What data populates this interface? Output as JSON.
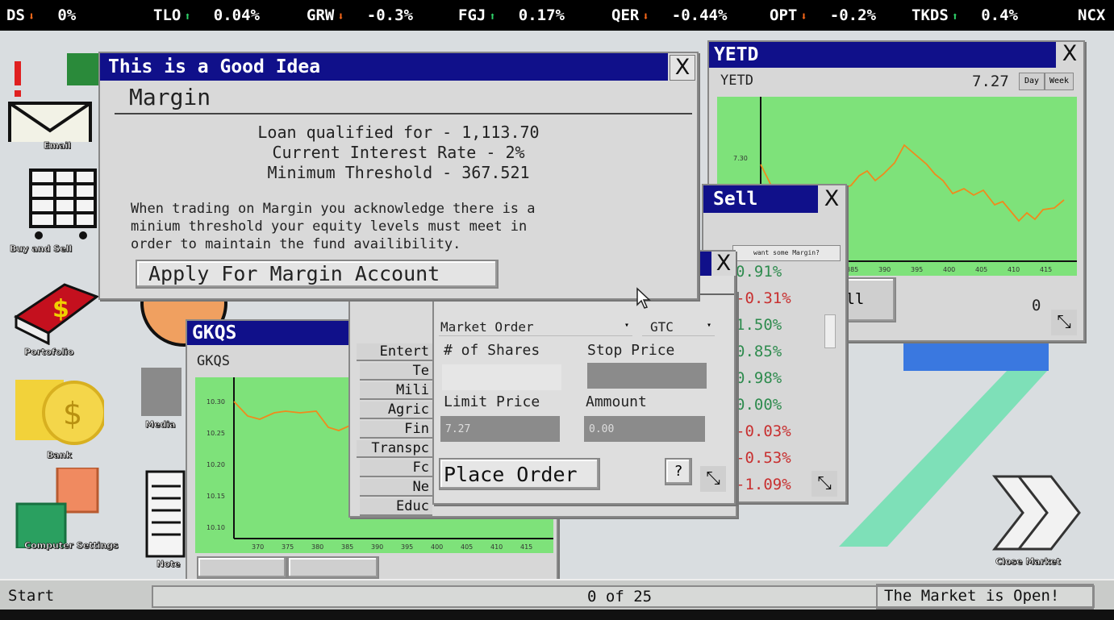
{
  "ticker": [
    {
      "sym": "DS",
      "dir": "down",
      "pct": "0%"
    },
    {
      "sym": "TLO",
      "dir": "up",
      "pct": "0.04%"
    },
    {
      "sym": "GRW",
      "dir": "down",
      "pct": "-0.3%"
    },
    {
      "sym": "FGJ",
      "dir": "up",
      "pct": "0.17%"
    },
    {
      "sym": "QER",
      "dir": "down",
      "pct": "-0.44%"
    },
    {
      "sym": "OPT",
      "dir": "down",
      "pct": "-0.2%"
    },
    {
      "sym": "TKDS",
      "dir": "up",
      "pct": "0.4%"
    },
    {
      "sym": "NCX",
      "dir": "",
      "pct": ""
    }
  ],
  "icons": {
    "email": "Email",
    "buy_sell": "Buy and Sell",
    "portfolio": "Portofolio",
    "bank": "Bank",
    "computer_settings": "Computer Settings",
    "media": "Media",
    "notes": "Note",
    "close_market": "Close Market"
  },
  "margin_window": {
    "title": "This is a Good Idea",
    "heading": "Margin",
    "loan": "Loan qualified for - 1,113.70",
    "rate": "Current Interest Rate - 2%",
    "threshold": "Minimum Threshold - 367.521",
    "notice_1": "When trading on Margin you acknowledge there is a",
    "notice_2": "minium threshold your equity levels must meet in",
    "notice_3": "order to maintain the fund availibility.",
    "apply_button": "Apply For Margin Account",
    "close": "X"
  },
  "yetd_window": {
    "title": "YETD",
    "symbol": "YETD",
    "price": "7.27",
    "range_day": "Day",
    "range_week": "Week",
    "close": "X",
    "y_tick": "7.30",
    "x_ticks": [
      "385",
      "390",
      "395",
      "400",
      "405",
      "410",
      "415"
    ],
    "sell_label": "ell",
    "qty": "0"
  },
  "buysell_window": {
    "title": "Sell",
    "close": "X",
    "margin_button": "want some Margin?",
    "changes": [
      "0.91%",
      "-0.31%",
      "1.50%",
      "0.85%",
      "0.98%",
      "0.00%",
      "-0.03%",
      "-0.53%",
      "-1.09%"
    ]
  },
  "sectors": [
    "Entert",
    "Te",
    "Mili",
    "Agric",
    "Fin",
    "Transpc",
    "Fc",
    "Ne",
    "Educ"
  ],
  "order_window": {
    "close": "X",
    "order_type": "Market Order",
    "duration": "GTC",
    "shares_label": "# of Shares",
    "stop_label": "Stop Price",
    "limit_label": "Limit Price",
    "amount_label": "Ammount",
    "limit_value": "7.27",
    "amount_value": "0.00",
    "place_button": "Place Order",
    "help": "?"
  },
  "gkqs_window": {
    "title": "GKQS",
    "symbol": "GKQS",
    "y_ticks": [
      "10.30",
      "10.25",
      "10.20",
      "10.15",
      "10.10"
    ],
    "x_ticks": [
      "370",
      "375",
      "380",
      "385",
      "390",
      "395",
      "400",
      "405",
      "410",
      "415"
    ]
  },
  "taskbar": {
    "start": "Start",
    "count": "0 of 25",
    "status": "The Market is Open!"
  },
  "colors": {
    "titlebar": "#10108a",
    "chart_bg": "#7ee27a",
    "line": "#f08a1c",
    "up": "#2fd36a",
    "down": "#ff6a1a"
  }
}
